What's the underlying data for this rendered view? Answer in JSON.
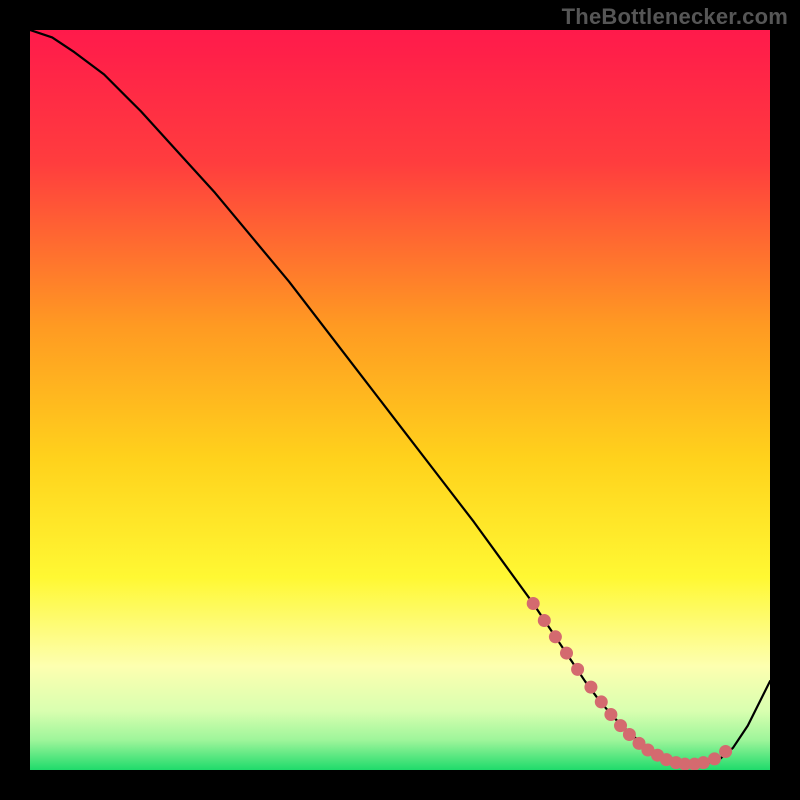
{
  "attribution": "TheBottlenecker.com",
  "chart_data": {
    "type": "line",
    "title": "",
    "xlabel": "",
    "ylabel": "",
    "xlim": [
      0,
      100
    ],
    "ylim": [
      0,
      100
    ],
    "gradient_stops": [
      {
        "offset": 0.0,
        "color": "#ff1a4b"
      },
      {
        "offset": 0.18,
        "color": "#ff3d3e"
      },
      {
        "offset": 0.4,
        "color": "#ff9a22"
      },
      {
        "offset": 0.58,
        "color": "#ffd21c"
      },
      {
        "offset": 0.74,
        "color": "#fff833"
      },
      {
        "offset": 0.86,
        "color": "#fdffb0"
      },
      {
        "offset": 0.92,
        "color": "#d9ffb0"
      },
      {
        "offset": 0.96,
        "color": "#9df59a"
      },
      {
        "offset": 1.0,
        "color": "#1fdb6b"
      }
    ],
    "series": [
      {
        "name": "bottleneck-curve",
        "x": [
          0,
          3,
          6,
          10,
          15,
          20,
          25,
          30,
          35,
          40,
          45,
          50,
          55,
          60,
          64,
          68,
          71,
          73,
          75,
          77,
          79,
          81,
          83,
          85,
          87,
          89,
          91,
          93,
          95,
          97,
          100
        ],
        "y": [
          100,
          99,
          97,
          94,
          89,
          83.5,
          78,
          72,
          66,
          59.5,
          53,
          46.5,
          40,
          33.5,
          28,
          22.5,
          18,
          15,
          12,
          9.3,
          7.0,
          5.0,
          3.4,
          2.2,
          1.3,
          0.8,
          0.8,
          1.3,
          3.0,
          6.0,
          12
        ]
      }
    ],
    "markers": {
      "name": "highlight-segment",
      "color": "#d46a6f",
      "points": [
        {
          "x": 68.0,
          "y": 22.5
        },
        {
          "x": 69.5,
          "y": 20.2
        },
        {
          "x": 71.0,
          "y": 18.0
        },
        {
          "x": 72.5,
          "y": 15.8
        },
        {
          "x": 74.0,
          "y": 13.6
        },
        {
          "x": 75.8,
          "y": 11.2
        },
        {
          "x": 77.2,
          "y": 9.2
        },
        {
          "x": 78.5,
          "y": 7.5
        },
        {
          "x": 79.8,
          "y": 6.0
        },
        {
          "x": 81.0,
          "y": 4.8
        },
        {
          "x": 82.3,
          "y": 3.6
        },
        {
          "x": 83.5,
          "y": 2.7
        },
        {
          "x": 84.8,
          "y": 2.0
        },
        {
          "x": 86.0,
          "y": 1.4
        },
        {
          "x": 87.3,
          "y": 1.0
        },
        {
          "x": 88.5,
          "y": 0.8
        },
        {
          "x": 89.8,
          "y": 0.8
        },
        {
          "x": 91.0,
          "y": 1.0
        },
        {
          "x": 92.5,
          "y": 1.5
        },
        {
          "x": 94.0,
          "y": 2.5
        }
      ]
    }
  }
}
